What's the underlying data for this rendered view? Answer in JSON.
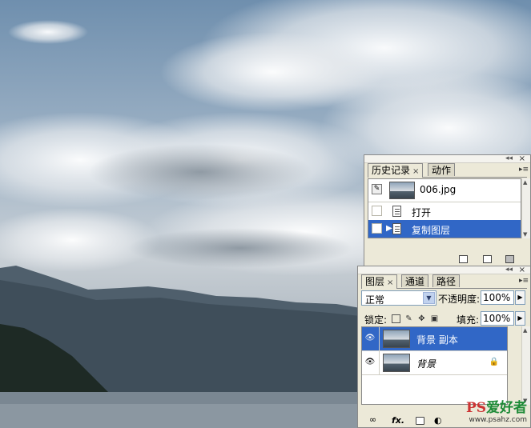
{
  "history_panel": {
    "tabs": [
      {
        "label": "历史记录",
        "close": "×",
        "active": true
      },
      {
        "label": "动作",
        "active": false
      }
    ],
    "snapshot": {
      "name": "006.jpg"
    },
    "steps": [
      {
        "label": "打开",
        "selected": false
      },
      {
        "label": "复制图层",
        "selected": true
      }
    ]
  },
  "layers_panel": {
    "tabs": [
      {
        "label": "图层",
        "close": "×",
        "active": true
      },
      {
        "label": "通道",
        "active": false
      },
      {
        "label": "路径",
        "active": false
      }
    ],
    "blend_mode": "正常",
    "opacity_label": "不透明度:",
    "opacity_value": "100%",
    "lock_label": "锁定:",
    "fill_label": "填充:",
    "fill_value": "100%",
    "layers": [
      {
        "name": "背景 副本",
        "selected": true,
        "locked": false
      },
      {
        "name": "背景",
        "selected": false,
        "locked": true
      }
    ]
  },
  "watermark": {
    "brand": "PS",
    "brand_text": "爱好者",
    "url": "www.psahz.com"
  },
  "colors": {
    "selection": "#3167c6",
    "panel_bg": "#ece9d8"
  }
}
